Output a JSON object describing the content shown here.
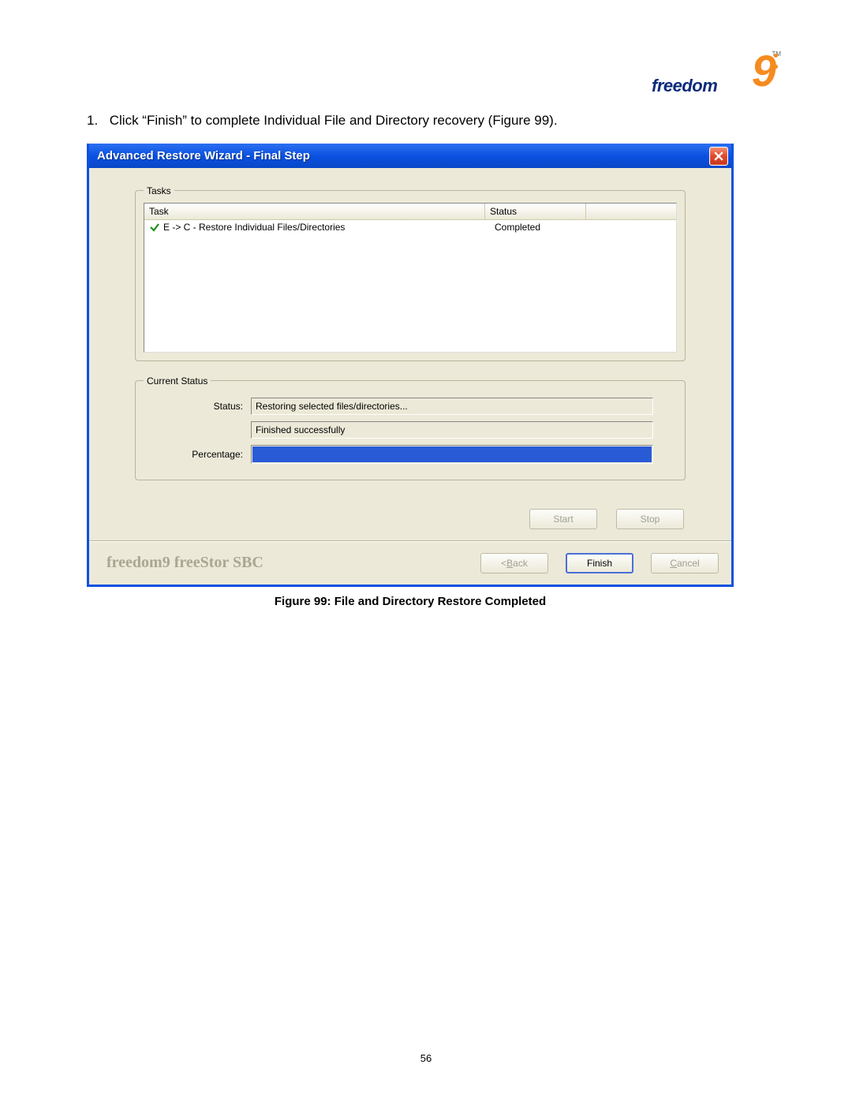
{
  "logo": {
    "brand": "freedom",
    "nine": "9",
    "tm": "TM"
  },
  "instruction": {
    "number": "1.",
    "text": "Click “Finish” to complete Individual File and Directory recovery (Figure 99)."
  },
  "window": {
    "title": "Advanced Restore Wizard - Final Step",
    "tasks": {
      "legend": "Tasks",
      "headers": {
        "task": "Task",
        "status": "Status"
      },
      "rows": [
        {
          "icon": "check-icon",
          "task": "E -> C - Restore Individual Files/Directories",
          "status": "Completed"
        }
      ]
    },
    "current_status": {
      "legend": "Current Status",
      "status_label": "Status:",
      "line1": "Restoring selected files/directories...",
      "line2": "Finished successfully",
      "percentage_label": "Percentage:",
      "percentage_value": 100
    },
    "buttons": {
      "start": "Start",
      "stop": "Stop",
      "back_prefix": "< ",
      "back_u": "B",
      "back_suffix": "ack",
      "finish": "Finish",
      "cancel_u": "C",
      "cancel_suffix": "ancel"
    },
    "brand": "freedom9 freeStor SBC"
  },
  "caption": "Figure 99: File and Directory Restore Completed",
  "page_number": "56"
}
